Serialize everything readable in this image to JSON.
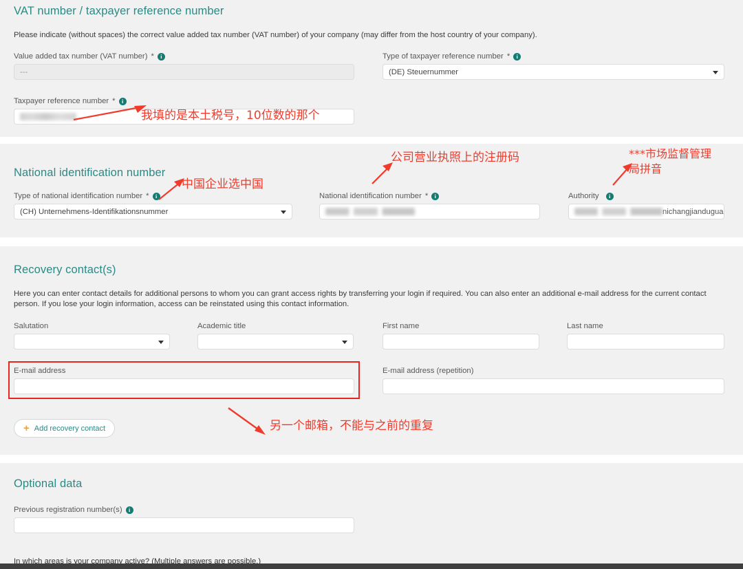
{
  "sections": {
    "vat": {
      "title": "VAT number / taxpayer reference number",
      "description": "Please indicate (without spaces) the correct value added tax number (VAT number) of your company (may differ from the host country of your company).",
      "fields": {
        "vat_number": {
          "label": "Value added tax number (VAT number)",
          "required_mark": "*",
          "value": "---",
          "disabled": true
        },
        "taxpayer_type": {
          "label": "Type of taxpayer reference number",
          "required_mark": "*",
          "value": "(DE) Steuernummer"
        },
        "taxpayer_reference": {
          "label": "Taxpayer reference number",
          "required_mark": "*",
          "value": "",
          "redacted": true
        }
      },
      "annotation": "我填的是本土税号，10位数的那个"
    },
    "national_id": {
      "title": "National identification number",
      "fields": {
        "type": {
          "label": "Type of national identification number",
          "required_mark": "*",
          "value": "(CH) Unternehmens-Identifikationsnummer"
        },
        "number": {
          "label": "National identification number",
          "required_mark": "*",
          "value": "",
          "redacted": true
        },
        "authority": {
          "label": "Authority",
          "required_mark": "",
          "value_visible_tail": "nichangjianduguan",
          "redacted": true
        }
      },
      "annotations": {
        "type": "中国企业选中国",
        "number": "公司营业执照上的注册码",
        "authority_line1": "***市场监督管理",
        "authority_line2": "局拼音"
      }
    },
    "recovery": {
      "title": "Recovery contact(s)",
      "description": "Here you can enter contact details for additional persons to whom you can grant access rights by transferring your login if required. You can also enter an additional e-mail address for the current contact person. If you lose your login information, access can be reinstated using this contact information.",
      "fields": {
        "salutation": {
          "label": "Salutation",
          "value": ""
        },
        "academic_title": {
          "label": "Academic title",
          "value": ""
        },
        "first_name": {
          "label": "First name",
          "value": ""
        },
        "last_name": {
          "label": "Last name",
          "value": ""
        },
        "email": {
          "label": "E-mail address",
          "value": ""
        },
        "email_repeat": {
          "label": "E-mail address (repetition)",
          "value": ""
        }
      },
      "add_button": {
        "label": "Add recovery contact",
        "icon": "plus-icon"
      },
      "annotation": "另一个邮箱，不能与之前的重复",
      "highlight_color": "#e8251f"
    },
    "optional": {
      "title": "Optional data",
      "fields": {
        "previous_registration": {
          "label": "Previous registration number(s)",
          "required_mark": "",
          "value": ""
        }
      },
      "bottom_question": "In which areas is your company active? (Multiple answers are possible.)"
    }
  },
  "colors": {
    "section_heading": "#2a8a85",
    "info_icon": "#157c72",
    "annotation": "#ef3b2c",
    "highlight_border": "#e8251f",
    "plus_icon": "#e8a33d",
    "section_background": "#f1f1f1",
    "page_background": "#ffffff"
  },
  "icons": {
    "info": "i",
    "dropdown": "chevron-down-icon",
    "plus": "+"
  }
}
